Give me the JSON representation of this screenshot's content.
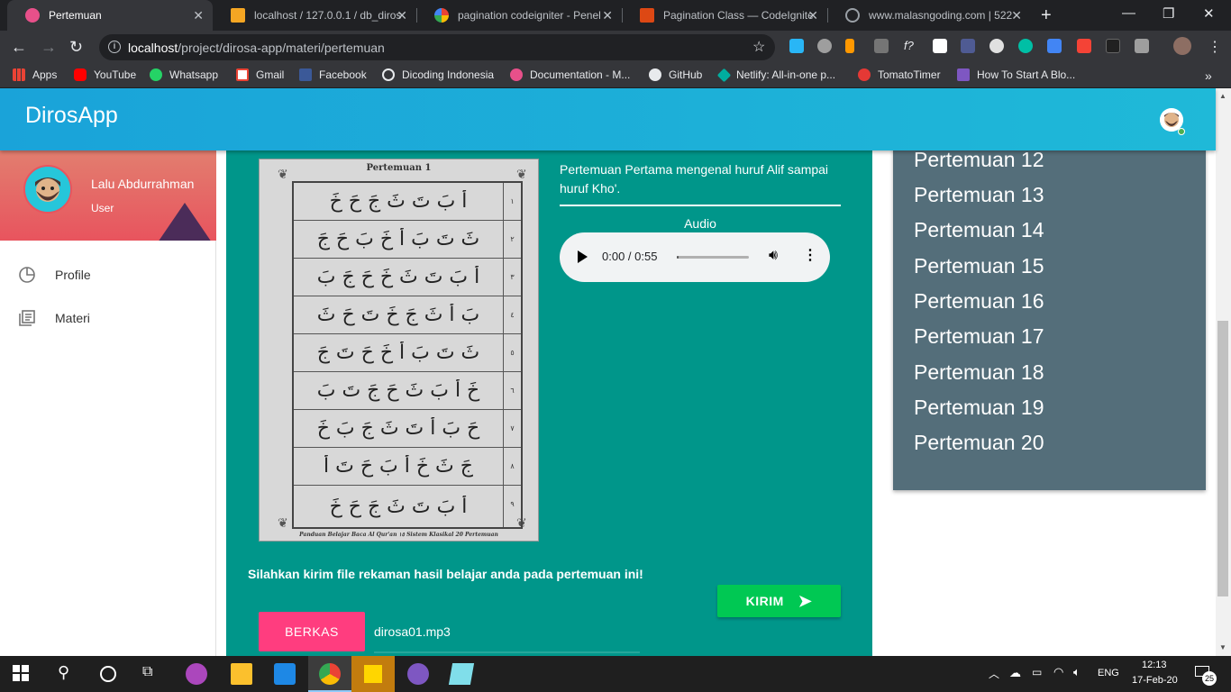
{
  "browser": {
    "tabs": [
      {
        "title": "Pertemuan",
        "active": true
      },
      {
        "title": "localhost / 127.0.0.1 / db_diros",
        "active": false
      },
      {
        "title": "pagination codeigniter - Penel",
        "active": false
      },
      {
        "title": "Pagination Class — CodeIgnite",
        "active": false
      },
      {
        "title": "www.malasngoding.com | 522",
        "active": false
      }
    ],
    "url_host": "localhost",
    "url_path": "/project/dirosa-app/materi/pertemuan",
    "bookmarks": [
      "Apps",
      "YouTube",
      "Whatsapp",
      "Gmail",
      "Facebook",
      "Dicoding Indonesia",
      "Documentation - M...",
      "GitHub",
      "Netlify: All-in-one p...",
      "TomatoTimer",
      "How To Start A Blo..."
    ]
  },
  "app": {
    "brand": "DirosApp",
    "user": {
      "name": "Lalu Abdurrahman",
      "role": "User"
    },
    "nav": [
      {
        "label": "Profile",
        "icon": "dashboard-icon"
      },
      {
        "label": "Materi",
        "icon": "library-books-icon"
      }
    ],
    "lesson": {
      "page_title": "Pertemuan 1",
      "page_footer_left": "Panduan Belajar Baca Al Qur'an",
      "page_number": "١٥",
      "page_footer_right": "Sistem Klasikal 20 Pertemuan",
      "rows": [
        {
          "num": "١",
          "text": "أَ بَ تَ ثَ جَ حَ خَ"
        },
        {
          "num": "٢",
          "text": "ثَ تَ بَ أَ خَ بَ حَ جَ"
        },
        {
          "num": "٣",
          "text": "أَ بَ تَ ثَ خَ حَ جَ بَ"
        },
        {
          "num": "٤",
          "text": "بَ أَ ثَ جَ خَ تَ حَ ثَ"
        },
        {
          "num": "٥",
          "text": "ثَ تَ بَ أَ خَ حَ تَ جَ"
        },
        {
          "num": "٦",
          "text": "خَ أَ بَ ثَ حَ جَ تَ بَ"
        },
        {
          "num": "٧",
          "text": "حَ بَ أَ تَ ثَ جَ بَ خَ"
        },
        {
          "num": "٨",
          "text": "جَ ثَ خَ أَ بَ حَ تَ أَ"
        },
        {
          "num": "٩",
          "text": "أَ بَ تَ ثَ جَ حَ خَ"
        }
      ],
      "description": "Pertemuan Pertama mengenal huruf Alif sampai huruf Kho'.",
      "audio_label": "Audio",
      "audio_time": "0:00 / 0:55",
      "audio_progress": 0.0,
      "instruction": "Silahkan kirim file rekaman hasil belajar anda pada pertemuan ini!",
      "send_label": "KIRIM",
      "file_button_label": "BERKAS",
      "file_name": "dirosa01.mp3"
    },
    "meetings": [
      "Pertemuan 12",
      "Pertemuan 13",
      "Pertemuan 14",
      "Pertemuan 15",
      "Pertemuan 16",
      "Pertemuan 17",
      "Pertemuan 18",
      "Pertemuan 19",
      "Pertemuan 20"
    ]
  },
  "taskbar": {
    "language": "ENG",
    "time": "12:13",
    "date": "17-Feb-20",
    "notifications": "25"
  },
  "colors": {
    "appbar": "#1aa3d9",
    "card": "#00968a",
    "panel": "#546e7a",
    "send_button": "#00c853",
    "file_button": "#ff3d7f"
  }
}
